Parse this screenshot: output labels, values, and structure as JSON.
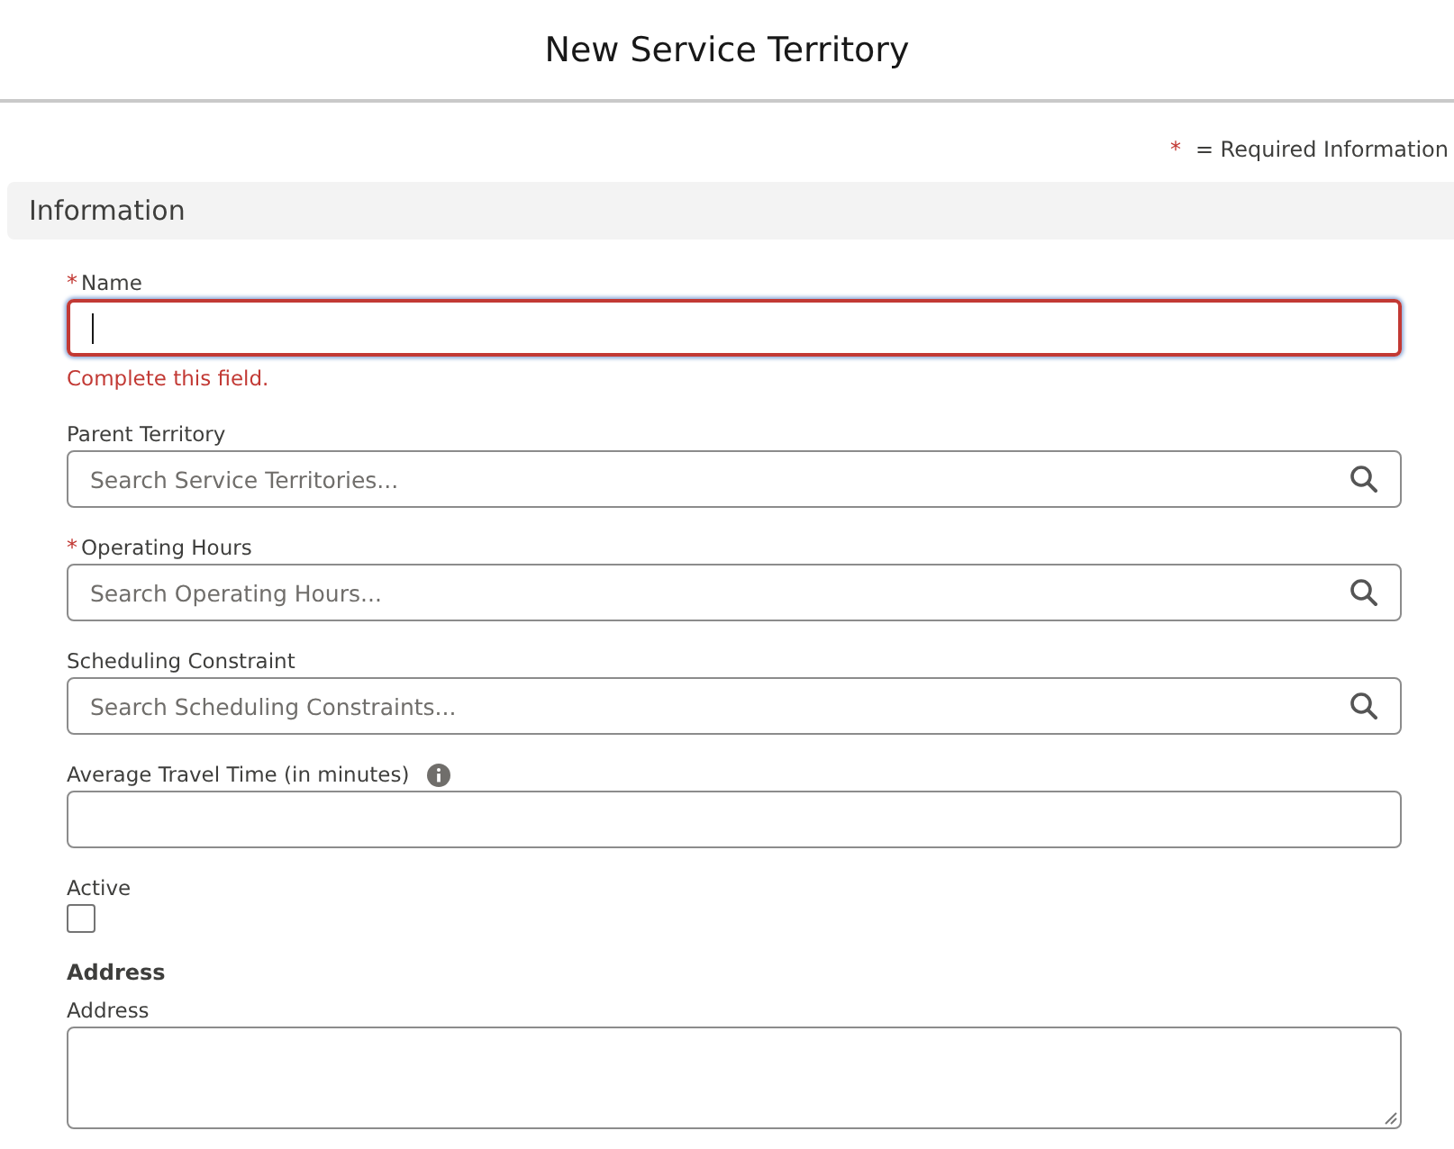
{
  "window": {
    "title": "New Service Territory"
  },
  "legend": {
    "marker": "*",
    "text": "= Required Information"
  },
  "section": {
    "title": "Information"
  },
  "fields": [
    {
      "kind": "text",
      "label": "Name",
      "required": true,
      "focused": true,
      "error": "Complete this field."
    },
    {
      "kind": "lookup",
      "label": "Parent Territory",
      "required": false,
      "placeholder": "Search Service Territories..."
    },
    {
      "kind": "lookup",
      "label": "Operating Hours",
      "required": true,
      "placeholder": "Search Operating Hours..."
    },
    {
      "kind": "lookup",
      "label": "Scheduling Constraint",
      "required": false,
      "placeholder": "Search Scheduling Constraints..."
    },
    {
      "kind": "number",
      "label": "Average Travel Time (in minutes)",
      "required": false,
      "info": true
    },
    {
      "kind": "checkbox",
      "label": "Active",
      "required": false,
      "checked": false
    },
    {
      "kind": "heading",
      "label": "Address"
    },
    {
      "kind": "textarea",
      "label": "Address",
      "required": false
    }
  ]
}
